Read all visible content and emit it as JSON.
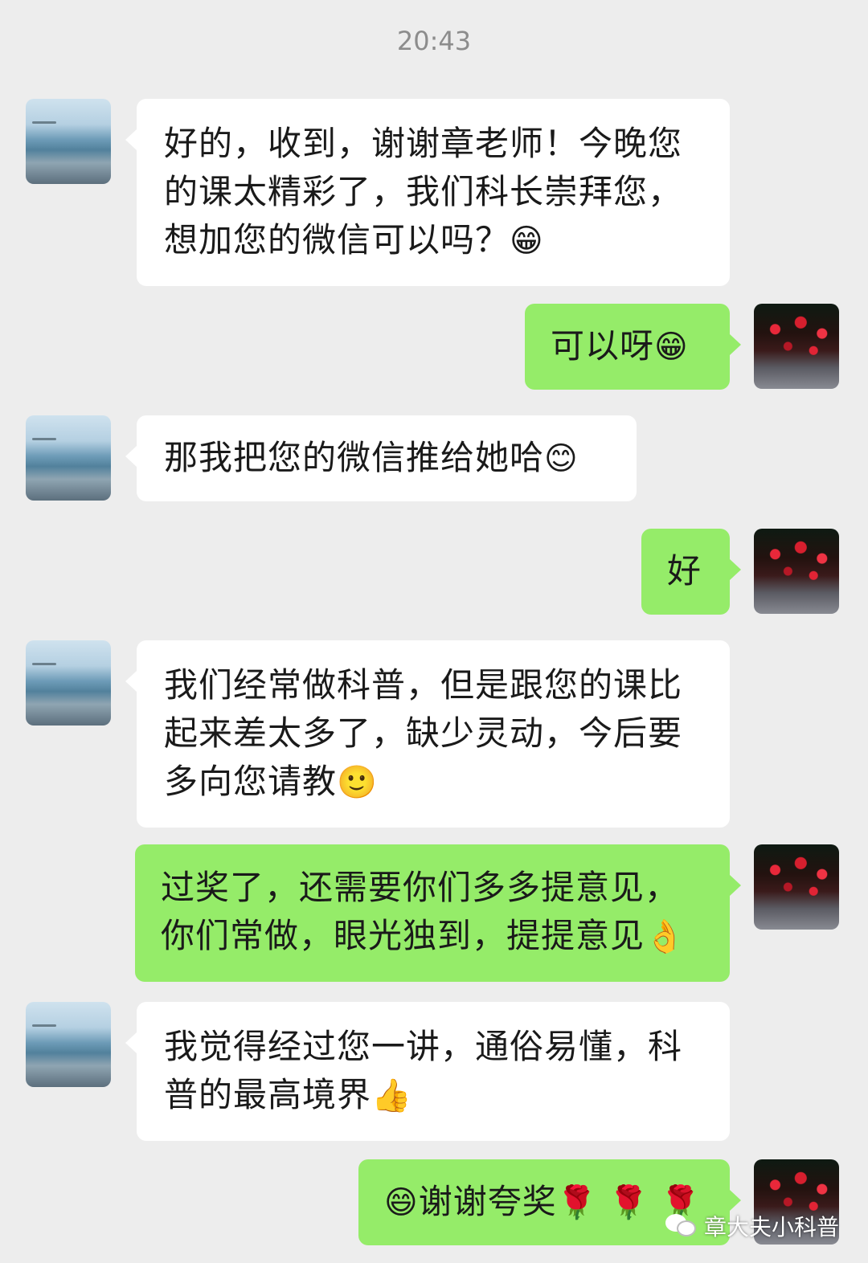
{
  "timestamp": "20:43",
  "messages": [
    {
      "side": "left",
      "text": "好的，收到，谢谢章老师！今晚您的课太精彩了，我们科长崇拜您，想加您的微信可以吗？",
      "emoji": "😁"
    },
    {
      "side": "right",
      "text": "可以呀",
      "emoji": "😁"
    },
    {
      "side": "left",
      "text": "那我把您的微信推给她哈",
      "emoji": "😊"
    },
    {
      "side": "right",
      "text": "好",
      "emoji": ""
    },
    {
      "side": "left",
      "text": "我们经常做科普，但是跟您的课比起来差太多了，缺少灵动，今后要多向您请教",
      "emoji": "🙂"
    },
    {
      "side": "right",
      "text": "过奖了，还需要你们多多提意见，你们常做，眼光独到，提提意见",
      "emoji": "👌"
    },
    {
      "side": "left",
      "text": "我觉得经过您一讲，通俗易懂，科普的最高境界",
      "emoji": "👍"
    },
    {
      "side": "right",
      "text": "谢谢夸奖",
      "emoji_before": "😄",
      "emoji": "🌹 🌹 🌹"
    }
  ],
  "watermark": {
    "text": "章大夫小科普",
    "icon": "wechat-icon"
  },
  "avatars": {
    "left": "sea-landscape-avatar",
    "right": "night-lights-avatar"
  }
}
